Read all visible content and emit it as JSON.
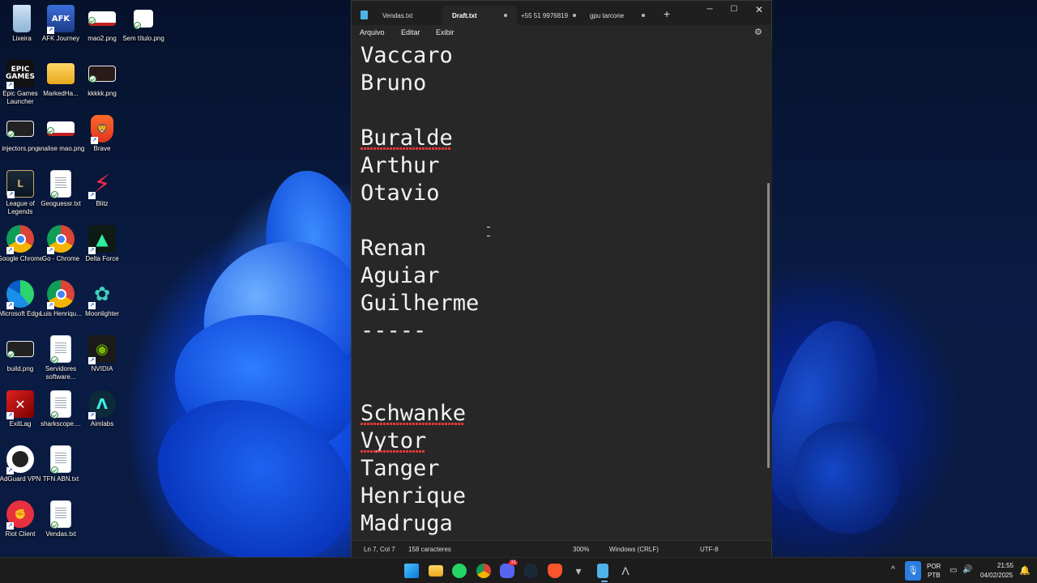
{
  "desktop": {
    "icons": [
      {
        "label": "Lixeira",
        "icon": "recycle-bin-icon"
      },
      {
        "label": "AFK Journey",
        "icon": "afk-journey-icon"
      },
      {
        "label": "mao2.png",
        "icon": "image-file-icon"
      },
      {
        "label": "Sem título.png",
        "icon": "image-file-icon"
      },
      {
        "label": "Epic Games Launcher",
        "icon": "epic-games-icon",
        "text": "EPIC\nGAMES"
      },
      {
        "label": "MarkedHa...",
        "icon": "folder-icon"
      },
      {
        "label": "kkkkk.png",
        "icon": "image-file-icon"
      },
      {
        "label": "injectors.png",
        "icon": "image-file-icon"
      },
      {
        "label": "analise mao.png",
        "icon": "image-file-icon"
      },
      {
        "label": "Brave",
        "icon": "brave-icon"
      },
      {
        "label": "League of Legends",
        "icon": "league-of-legends-icon"
      },
      {
        "label": "Geoguessr.txt",
        "icon": "text-file-icon"
      },
      {
        "label": "Blitz",
        "icon": "blitz-icon"
      },
      {
        "label": "Google Chrome",
        "icon": "chrome-icon"
      },
      {
        "label": "Go - Chrome",
        "icon": "chrome-icon"
      },
      {
        "label": "Delta Force",
        "icon": "delta-force-icon"
      },
      {
        "label": "Microsoft Edge",
        "icon": "edge-icon"
      },
      {
        "label": "Luis Henriqu...",
        "icon": "chrome-icon"
      },
      {
        "label": "Moonlighter",
        "icon": "moonlighter-icon"
      },
      {
        "label": "build.png",
        "icon": "image-file-icon"
      },
      {
        "label": "Servidores software...",
        "icon": "text-file-icon"
      },
      {
        "label": "NVIDIA",
        "icon": "nvidia-icon"
      },
      {
        "label": "ExitLag",
        "icon": "exitlag-icon"
      },
      {
        "label": "sharkscope....",
        "icon": "text-file-icon"
      },
      {
        "label": "Aimlabs",
        "icon": "aimlabs-icon"
      },
      {
        "label": "AdGuard VPN",
        "icon": "adguard-vpn-icon"
      },
      {
        "label": "TFN ABN.txt",
        "icon": "text-file-icon"
      },
      {
        "label": "Riot Client",
        "icon": "riot-client-icon"
      },
      {
        "label": "Vendas.txt",
        "icon": "text-file-icon"
      }
    ]
  },
  "notepad": {
    "tabs": [
      {
        "label": "Vendas.txt",
        "active": false,
        "modified": false
      },
      {
        "label": "Draft.txt",
        "active": true,
        "modified": true
      },
      {
        "label": "+55 51 9976819",
        "active": false,
        "modified": true
      },
      {
        "label": "gpu tarcone",
        "active": false,
        "modified": true
      }
    ],
    "menu": [
      "Arquivo",
      "Editar",
      "Exibir"
    ],
    "lines": [
      "Vaccaro",
      "Bruno",
      "",
      "Buralde",
      "Arthur",
      "Otavio",
      "",
      "Renan",
      "Aguiar",
      "Guilherme",
      "-----",
      "",
      "",
      "Schwanke",
      "Vytor",
      "Tanger",
      "Henrique",
      "Madruga"
    ],
    "misspelled": [
      "Buralde",
      "Schwanke",
      "Vytor"
    ],
    "status": {
      "position": "Ln 7, Col 7",
      "chars": "158 caracteres",
      "zoom": "300%",
      "line_ending": "Windows (CRLF)",
      "encoding": "UTF-8"
    }
  },
  "taskbar": {
    "apps": [
      "start-icon",
      "file-explorer-icon",
      "whatsapp-icon",
      "chrome-icon",
      "discord-icon",
      "steam-icon",
      "brave-icon",
      "delta-force-icon",
      "notepad-icon",
      "aimlabs-icon"
    ],
    "discord_badge": "31",
    "language": "POR",
    "keyboard": "PTB",
    "time": "21:55",
    "date": "04/02/2025"
  },
  "colors": {
    "editor_bg": "#272727",
    "titlebar_bg": "#1f1f1f",
    "taskbar_bg": "#1c1c1c",
    "spell_error": "#e03a3a",
    "accent": "#6cb4ff"
  }
}
